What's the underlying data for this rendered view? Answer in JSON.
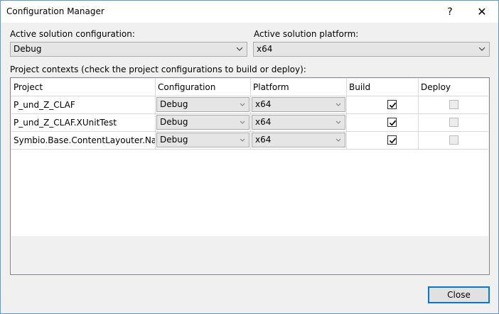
{
  "window": {
    "title": "Configuration Manager",
    "help_glyph": "?",
    "close_glyph": "✕"
  },
  "solution": {
    "config_label": "Active solution configuration:",
    "config_value": "Debug",
    "platform_label": "Active solution platform:",
    "platform_value": "x64"
  },
  "contexts": {
    "label": "Project contexts (check the project configurations to build or deploy):",
    "columns": [
      "Project",
      "Configuration",
      "Platform",
      "Build",
      "Deploy"
    ],
    "rows": [
      {
        "project": "P_und_Z_CLAF",
        "configuration": "Debug",
        "platform": "x64",
        "build": true,
        "deploy": false
      },
      {
        "project": "P_und_Z_CLAF.XUnitTest",
        "configuration": "Debug",
        "platform": "x64",
        "build": true,
        "deploy": false
      },
      {
        "project": "Symbio.Base.ContentLayouter.Native",
        "configuration": "Debug",
        "platform": "x64",
        "build": true,
        "deploy": false
      }
    ]
  },
  "footer": {
    "close_label": "Close"
  },
  "colors": {
    "accent": "#0078d7",
    "window_bg": "#f0f0f0",
    "combo_bg": "#e5e5e5",
    "grid_line": "#d9d9d9"
  },
  "icons": {
    "combo_arrow": "chevron-down-icon",
    "checkbox_mark": "check-icon"
  }
}
